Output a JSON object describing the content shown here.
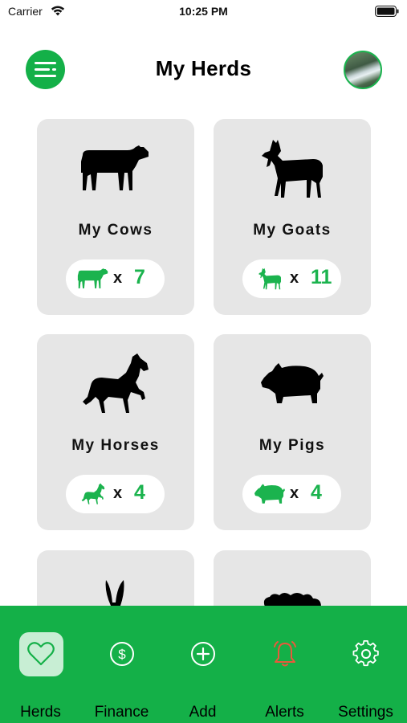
{
  "status_bar": {
    "carrier": "Carrier",
    "time": "10:25 PM"
  },
  "header": {
    "title": "My Herds",
    "menu_icon": "menu-lines-icon",
    "avatar_icon": "profile-photo"
  },
  "herds": [
    {
      "title": "My Cows",
      "count": "7",
      "icon": "cow-icon"
    },
    {
      "title": "My Goats",
      "count": "11",
      "icon": "goat-icon"
    },
    {
      "title": "My Horses",
      "count": "4",
      "icon": "horse-icon"
    },
    {
      "title": "My Pigs",
      "count": "4",
      "icon": "pig-icon"
    },
    {
      "title": "",
      "count": "",
      "icon": "rabbit-icon"
    },
    {
      "title": "",
      "count": "",
      "icon": "sheep-icon"
    }
  ],
  "count_multiplier": "x",
  "tabs": [
    {
      "label": "Herds",
      "icon": "heart-icon",
      "active": true
    },
    {
      "label": "Finance",
      "icon": "dollar-circle-icon",
      "active": false
    },
    {
      "label": "Add",
      "icon": "plus-circle-icon",
      "active": false
    },
    {
      "label": "Alerts",
      "icon": "bell-icon",
      "active": false
    },
    {
      "label": "Settings",
      "icon": "gear-icon",
      "active": false
    }
  ],
  "colors": {
    "brand_green": "#14b048",
    "count_green": "#1bb34e",
    "card_bg": "#e6e6e6",
    "active_tab_bg": "#c8eed4",
    "alert_icon": "#e8593c"
  }
}
